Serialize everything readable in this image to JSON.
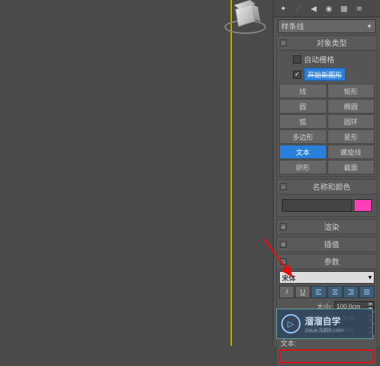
{
  "dropdown": {
    "category": "样条线"
  },
  "rollouts": {
    "objtype": {
      "title": "对象类型",
      "autogrid": "自动栅格",
      "startnew": "开始新图形"
    },
    "namecolor": {
      "title": "名称和颜色"
    },
    "render": {
      "title": "渲染"
    },
    "interp": {
      "title": "插值"
    },
    "params": {
      "title": "参数"
    }
  },
  "shapes": {
    "line": "线",
    "rect": "矩形",
    "circle": "圆",
    "ellipse": "椭圆",
    "arc": "弧",
    "donut": "圆环",
    "ngon": "多边形",
    "star": "星形",
    "text": "文本",
    "helix": "螺旋线",
    "egg": "卵形",
    "section": "截面"
  },
  "font": {
    "name": "宋体"
  },
  "textparams": {
    "size_lbl": "大小:",
    "size_val": "100.0cm",
    "kern_lbl": "字间距:",
    "kern_val": "0.0cm",
    "lead_lbl": "行间距:",
    "lead_val": "0.0cm",
    "text_lbl": "文本:"
  },
  "watermark": {
    "title": "溜溜自学",
    "url": "zixue.3d66.com"
  }
}
